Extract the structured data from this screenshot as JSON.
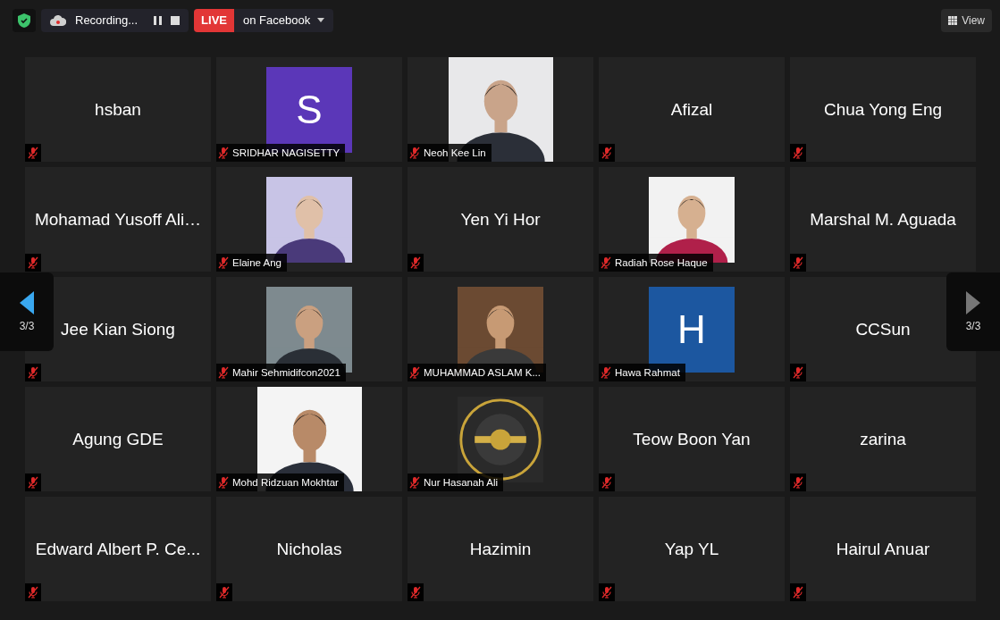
{
  "toolbar": {
    "recording": {
      "label": "Recording..."
    },
    "live": {
      "badge": "LIVE",
      "label": "on Facebook"
    },
    "view": {
      "label": "View"
    }
  },
  "nav": [
    {
      "kind": "previous",
      "label": "3/3",
      "disabled": false
    },
    {
      "kind": "next",
      "label": "3/3",
      "disabled": true
    }
  ],
  "tiles": [
    {
      "kind": "name",
      "name": "hsban"
    },
    {
      "kind": "initial",
      "name": "SRIDHAR NAGISETTY",
      "initial": "S",
      "color": "#5b37b8"
    },
    {
      "kind": "wide-picture",
      "name": "Neoh Kee Lin"
    },
    {
      "kind": "name",
      "name": "Afizal"
    },
    {
      "kind": "name",
      "name": "Chua Yong Eng"
    },
    {
      "kind": "name",
      "name": "Mohamad Yusoff Ali…"
    },
    {
      "kind": "picture",
      "name": "Elaine Ang"
    },
    {
      "kind": "name",
      "name": "Yen Yi Hor"
    },
    {
      "kind": "picture",
      "name": "Radiah Rose Haque"
    },
    {
      "kind": "name",
      "name": "Marshal M. Aguada"
    },
    {
      "kind": "name",
      "name": "Jee Kian Siong"
    },
    {
      "kind": "picture",
      "name": "Mahir Sehmidifcon2021"
    },
    {
      "kind": "picture",
      "name": "MUHAMMAD ASLAM K..."
    },
    {
      "kind": "initial",
      "name": "Hawa Rahmat",
      "initial": "H",
      "color": "#1c57a0"
    },
    {
      "kind": "name",
      "name": "CCSun"
    },
    {
      "kind": "name",
      "name": "Agung GDE"
    },
    {
      "kind": "wide-picture",
      "name": "Mohd Ridzuan Mokhtar"
    },
    {
      "kind": "picture",
      "name": "Nur Hasanah Ali"
    },
    {
      "kind": "name",
      "name": "Teow Boon Yan"
    },
    {
      "kind": "name",
      "name": "zarina"
    },
    {
      "kind": "name",
      "name": "Edward Albert P. Ce..."
    },
    {
      "kind": "name",
      "name": "Nicholas"
    },
    {
      "kind": "name",
      "name": "Hazimin"
    },
    {
      "kind": "name",
      "name": "Yap YL"
    },
    {
      "kind": "name",
      "name": "Hairul Anuar"
    }
  ]
}
